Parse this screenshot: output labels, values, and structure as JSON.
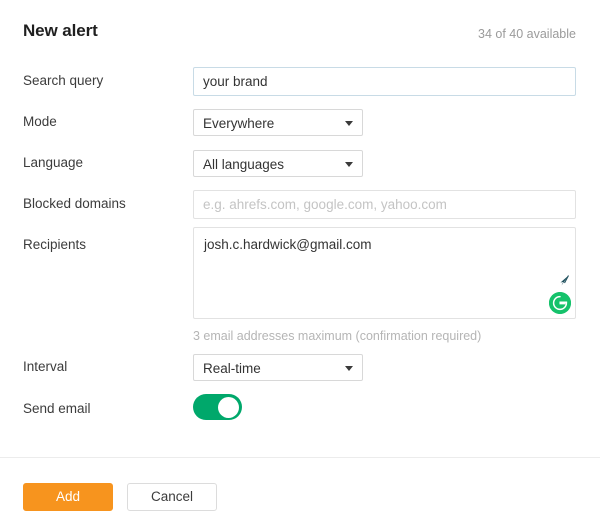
{
  "header": {
    "title": "New alert",
    "quota": "34 of 40 available"
  },
  "form": {
    "search_query": {
      "label": "Search query",
      "value": "your brand",
      "placeholder": ""
    },
    "mode": {
      "label": "Mode",
      "value": "Everywhere",
      "caret_icon": "chevron-down-icon"
    },
    "language": {
      "label": "Language",
      "value": "All languages",
      "caret_icon": "chevron-down-icon"
    },
    "blocked_domains": {
      "label": "Blocked domains",
      "value": "",
      "placeholder": "e.g. ahrefs.com, google.com, yahoo.com"
    },
    "recipients": {
      "label": "Recipients",
      "value": "josh.c.hardwick@gmail.com",
      "placeholder": "",
      "help": "3 email addresses maximum (confirmation required)",
      "resize_icon": "resize-handle-icon",
      "assistant_icon": "grammarly-icon",
      "assistant_letter": "G"
    },
    "interval": {
      "label": "Interval",
      "value": "Real-time",
      "caret_icon": "chevron-down-icon"
    },
    "send_email": {
      "label": "Send email",
      "state": "on"
    }
  },
  "footer": {
    "add_label": "Add",
    "cancel_label": "Cancel"
  },
  "colors": {
    "accent_orange": "#f7941e",
    "toggle_green": "#00a86b",
    "grammarly_green": "#15c26b",
    "focus_border": "#c8dbe6",
    "label_text": "#3c3c3c",
    "muted_text": "#b5b5b5"
  }
}
